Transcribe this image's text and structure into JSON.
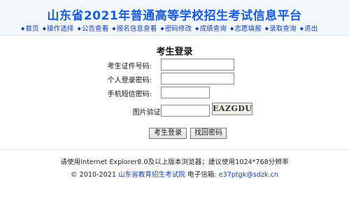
{
  "header": {
    "title": "山东省2021年普通高等学校招生考试信息平台",
    "nav": [
      "首页",
      "操作选择",
      "公告查看",
      "报名信息查看",
      "密码修改",
      "成绩查询",
      "志愿填报",
      "录取查询",
      "退出"
    ]
  },
  "login": {
    "title": "考生登录",
    "fields": {
      "id_label": "考生证件号码:",
      "password_label": "个人登录密码:",
      "sms_label": "手机短信密码:",
      "captcha_label": "图片验证码:"
    },
    "captcha_text": "EAZGDU",
    "login_button": "考生登录",
    "recover_button": "找回密码"
  },
  "footer": {
    "browser_note": "请使用Internet Explorer8.0及以上版本浏览器；建议使用1024*768分辨率",
    "copyright_prefix": "© 2010-2021",
    "org_link": "山东省教育招生考试院",
    "email_label": "电子信箱:",
    "email": "e37ptgk@sdzk.cn"
  },
  "colors": {
    "title": "#1a5bd8",
    "nav": "#1a3fb3",
    "header_bg": "#f3f8ff"
  }
}
